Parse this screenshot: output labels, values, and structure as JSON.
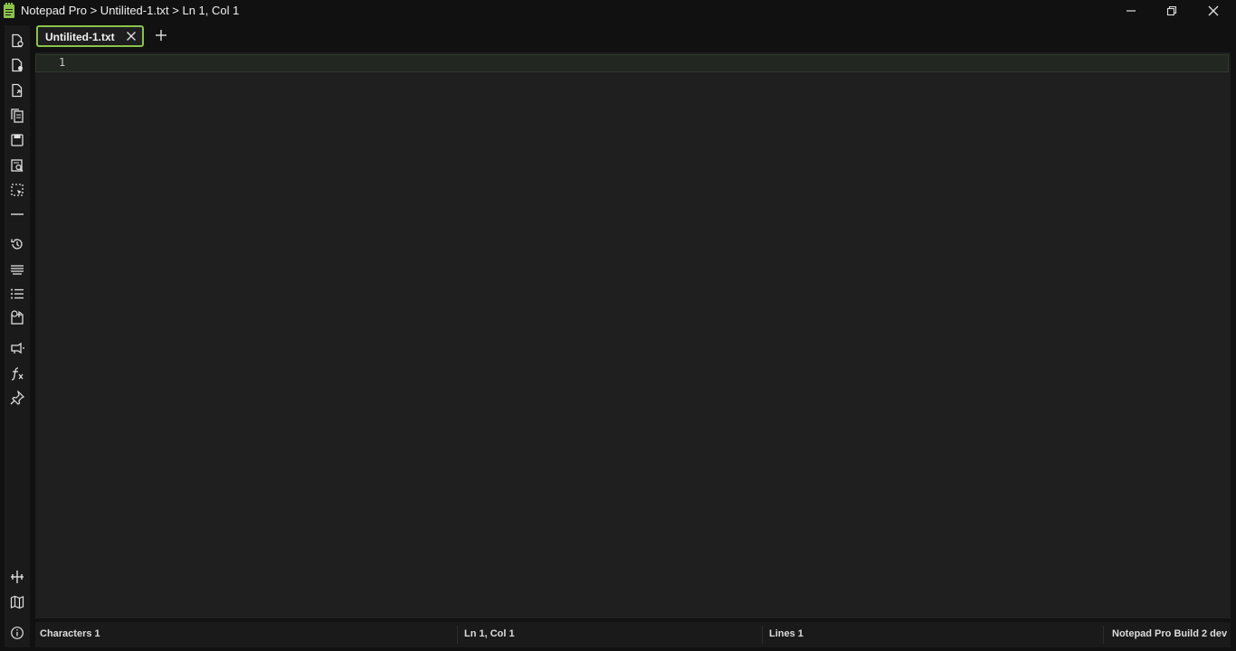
{
  "window": {
    "title": "Notepad Pro > Untilited-1.txt > Ln 1, Col 1",
    "accent": "#8bc34a"
  },
  "tabs": [
    {
      "label": "Untilited-1.txt",
      "active": true
    }
  ],
  "editor": {
    "line_numbers": [
      "1"
    ],
    "content": ""
  },
  "sidebar": {
    "icons": [
      "new-file-icon",
      "open-file-icon",
      "export-file-icon",
      "copy-file-icon",
      "save-icon",
      "find-in-file-icon",
      "select-all-icon",
      "divider-line-icon",
      "history-icon",
      "word-wrap-icon",
      "list-icon",
      "snippet-icon",
      "speaker-icon",
      "function-icon",
      "pin-icon",
      "split-view-icon",
      "book-icon",
      "info-icon"
    ]
  },
  "status": {
    "characters": "Characters 1",
    "position": "Ln 1, Col 1",
    "lines": "Lines 1",
    "build": "Notepad Pro Build 2 dev"
  }
}
